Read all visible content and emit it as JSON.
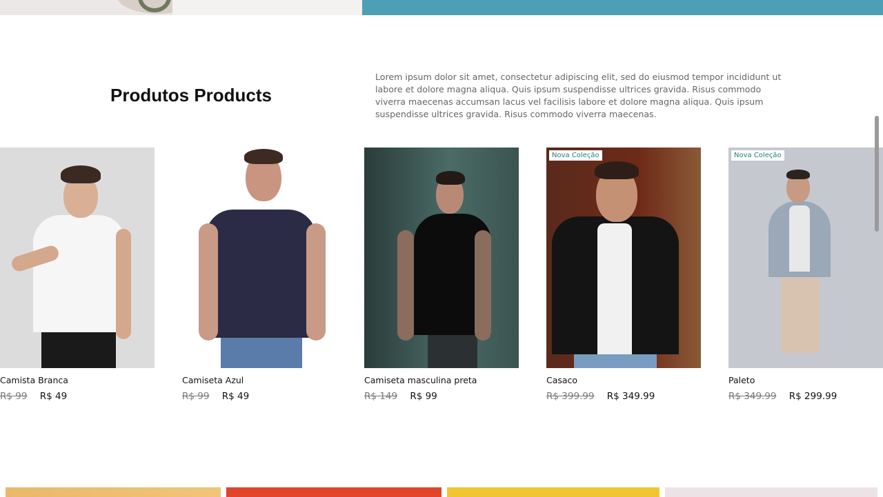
{
  "section": {
    "title": "Produtos Products",
    "description": "Lorem ipsum dolor sit amet, consectetur adipiscing elit, sed do eiusmod tempor incididunt ut labore et dolore magna aliqua. Quis ipsum suspendisse ultrices gravida. Risus commodo viverra maecenas accumsan lacus vel facilisis labore et dolore magna aliqua. Quis ipsum suspendisse ultrices gravida. Risus commodo viverra maecenas."
  },
  "products": [
    {
      "name": "Camista Branca",
      "old_price": "R$ 99",
      "new_price": "R$ 49",
      "badge": ""
    },
    {
      "name": "Camiseta Azul",
      "old_price": "R$ 99",
      "new_price": "R$ 49",
      "badge": ""
    },
    {
      "name": "Camiseta masculina preta",
      "old_price": "R$ 149",
      "new_price": "R$ 99",
      "badge": ""
    },
    {
      "name": "Casaco",
      "old_price": "R$ 399.99",
      "new_price": "R$ 349.99",
      "badge": "Nova Coleção"
    },
    {
      "name": "Paleto",
      "old_price": "R$ 349.99",
      "new_price": "R$ 299.99",
      "badge": "Nova Coleção"
    }
  ],
  "colors": {
    "badge_text": "#1d7e7e",
    "old_price": "#777777",
    "description_text": "#666666",
    "hero_blue": "#4d9fb6"
  }
}
